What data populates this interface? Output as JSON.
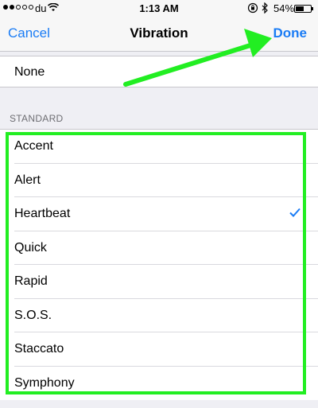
{
  "status_bar": {
    "signal_dots_filled": 2,
    "signal_dots_total": 5,
    "carrier": "du",
    "time": "1:13 AM",
    "battery": "54%",
    "battery_level": 0.54,
    "icons": [
      "wifi-icon",
      "orientation-lock-icon",
      "bluetooth-icon",
      "battery-icon"
    ]
  },
  "nav": {
    "cancel_label": "Cancel",
    "title": "Vibration",
    "done_label": "Done"
  },
  "none_option": {
    "label": "None"
  },
  "standard": {
    "header": "STANDARD",
    "items": [
      {
        "label": "Accent",
        "selected": false
      },
      {
        "label": "Alert",
        "selected": false
      },
      {
        "label": "Heartbeat",
        "selected": true
      },
      {
        "label": "Quick",
        "selected": false
      },
      {
        "label": "Rapid",
        "selected": false
      },
      {
        "label": "S.O.S.",
        "selected": false
      },
      {
        "label": "Staccato",
        "selected": false
      },
      {
        "label": "Symphony",
        "selected": false
      }
    ]
  },
  "colors": {
    "accent": "#1a7cf5",
    "annotation": "#22ee22",
    "background": "#efeff4"
  }
}
